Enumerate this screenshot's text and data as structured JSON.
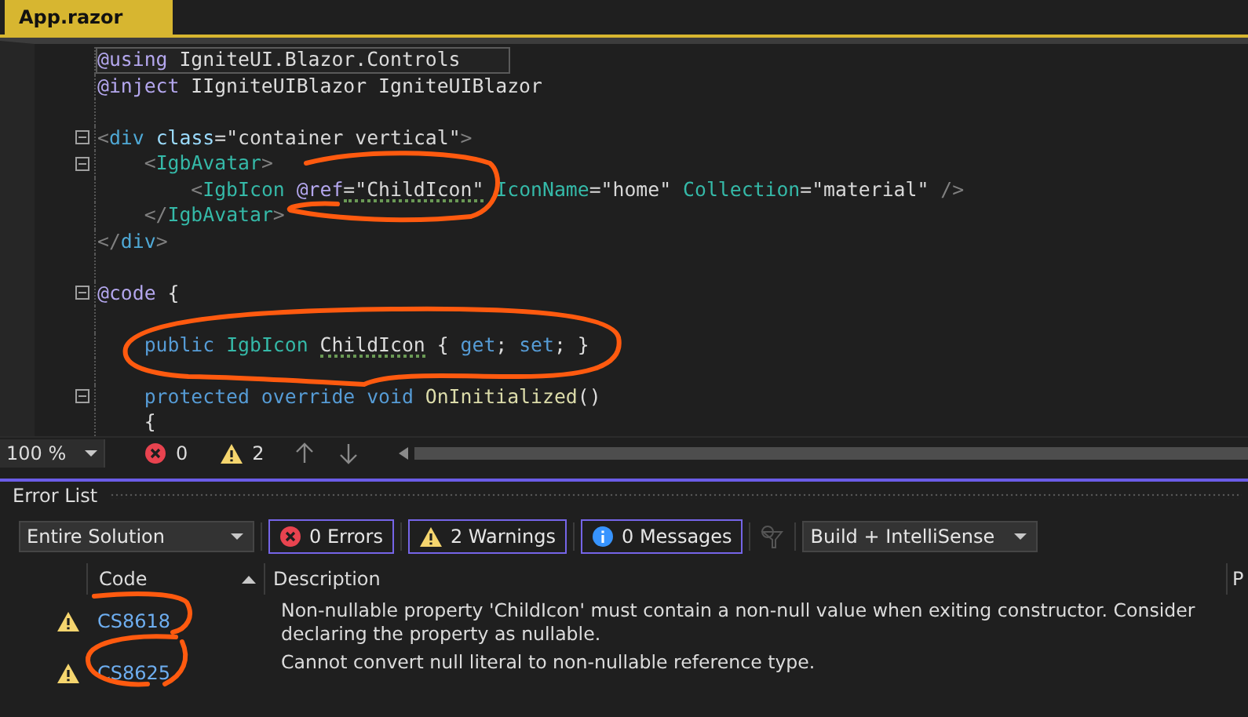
{
  "tabs": [
    {
      "label": "App.razor",
      "selected": true
    }
  ],
  "code_lines": [
    {
      "fold": false,
      "current": true,
      "tokens": [
        {
          "text": "@using",
          "kind": "directive"
        },
        {
          "text": " IgniteUI.Blazor.Controls",
          "kind": "text"
        }
      ]
    },
    {
      "fold": false,
      "current": false,
      "tokens": [
        {
          "text": "@inject",
          "kind": "directive"
        },
        {
          "text": " IIgniteUIBlazor IgniteUIBlazor",
          "kind": "text"
        }
      ]
    },
    {
      "fold": false,
      "current": false
    },
    {
      "fold": true,
      "current": false,
      "tokens": [
        {
          "text": "<",
          "kind": "punct"
        },
        {
          "text": "div",
          "kind": "tag"
        },
        {
          "text": " class",
          "kind": "attr"
        },
        {
          "text": "=\"container vertical\"",
          "kind": "string"
        },
        {
          "text": ">",
          "kind": "punct"
        }
      ]
    },
    {
      "fold": true,
      "current": false,
      "tokens": [
        {
          "text": "    <",
          "kind": "punct"
        },
        {
          "text": "IgbAvatar",
          "kind": "type"
        },
        {
          "text": ">",
          "kind": "punct"
        }
      ]
    },
    {
      "fold": false,
      "current": false,
      "tokens": [
        {
          "text": "        <",
          "kind": "punct"
        },
        {
          "text": "IgbIcon",
          "kind": "type"
        },
        {
          "text": " @ref",
          "kind": "directive"
        },
        {
          "text": "=\"ChildIcon\"",
          "kind": "string",
          "squiggle": true
        },
        {
          "text": " IconName",
          "kind": "type"
        },
        {
          "text": "=\"home\"",
          "kind": "string"
        },
        {
          "text": " Collection",
          "kind": "type"
        },
        {
          "text": "=\"material\"",
          "kind": "string"
        },
        {
          "text": " />",
          "kind": "punct"
        }
      ]
    },
    {
      "fold": false,
      "current": false,
      "tokens": [
        {
          "text": "    </",
          "kind": "punct"
        },
        {
          "text": "IgbAvatar",
          "kind": "type"
        },
        {
          "text": ">",
          "kind": "punct"
        }
      ]
    },
    {
      "fold": false,
      "current": false,
      "tokens": [
        {
          "text": "</",
          "kind": "punct"
        },
        {
          "text": "div",
          "kind": "tag"
        },
        {
          "text": ">",
          "kind": "punct"
        }
      ]
    },
    {
      "fold": false,
      "current": false
    },
    {
      "fold": true,
      "current": false,
      "tokens": [
        {
          "text": "@code",
          "kind": "directive"
        },
        {
          "text": " {",
          "kind": "text"
        }
      ]
    },
    {
      "fold": false,
      "current": false
    },
    {
      "fold": false,
      "current": false,
      "tokens": [
        {
          "text": "    public",
          "kind": "keyword"
        },
        {
          "text": " IgbIcon ",
          "kind": "type"
        },
        {
          "text": "ChildIcon",
          "kind": "text",
          "squiggle": true
        },
        {
          "text": " { ",
          "kind": "text"
        },
        {
          "text": "get",
          "kind": "keyword"
        },
        {
          "text": "; ",
          "kind": "text"
        },
        {
          "text": "set",
          "kind": "keyword"
        },
        {
          "text": "; }",
          "kind": "text"
        }
      ]
    },
    {
      "fold": false,
      "current": false
    },
    {
      "fold": true,
      "current": false,
      "tokens": [
        {
          "text": "    protected override void",
          "kind": "keyword"
        },
        {
          "text": " OnInitialized",
          "kind": "method"
        },
        {
          "text": "()",
          "kind": "text"
        }
      ]
    },
    {
      "fold": false,
      "current": false,
      "tokens": [
        {
          "text": "    {",
          "kind": "text"
        }
      ]
    }
  ],
  "status_bar": {
    "zoom": "100 %",
    "errors": "0",
    "warnings": "2"
  },
  "error_list": {
    "title": "Error List",
    "scope": "Entire Solution",
    "filters": [
      {
        "kind": "error",
        "label": "0 Errors",
        "selected": true
      },
      {
        "kind": "warning",
        "label": "2 Warnings",
        "selected": true
      },
      {
        "kind": "info",
        "label": "0 Messages",
        "selected": true
      }
    ],
    "source": "Build + IntelliSense",
    "columns": [
      {
        "label": "Code",
        "sorted": true
      },
      {
        "label": "Description",
        "sorted": false
      },
      {
        "label": "P",
        "sorted": false
      }
    ],
    "rows": [
      {
        "kind": "warning",
        "code": "CS8618",
        "description": "Non-nullable property 'ChildIcon' must contain a non-null value when exiting constructor. Consider declaring the property as nullable."
      },
      {
        "kind": "warning",
        "code": "CS8625",
        "description": "Cannot convert null literal to non-nullable reference type."
      }
    ]
  }
}
